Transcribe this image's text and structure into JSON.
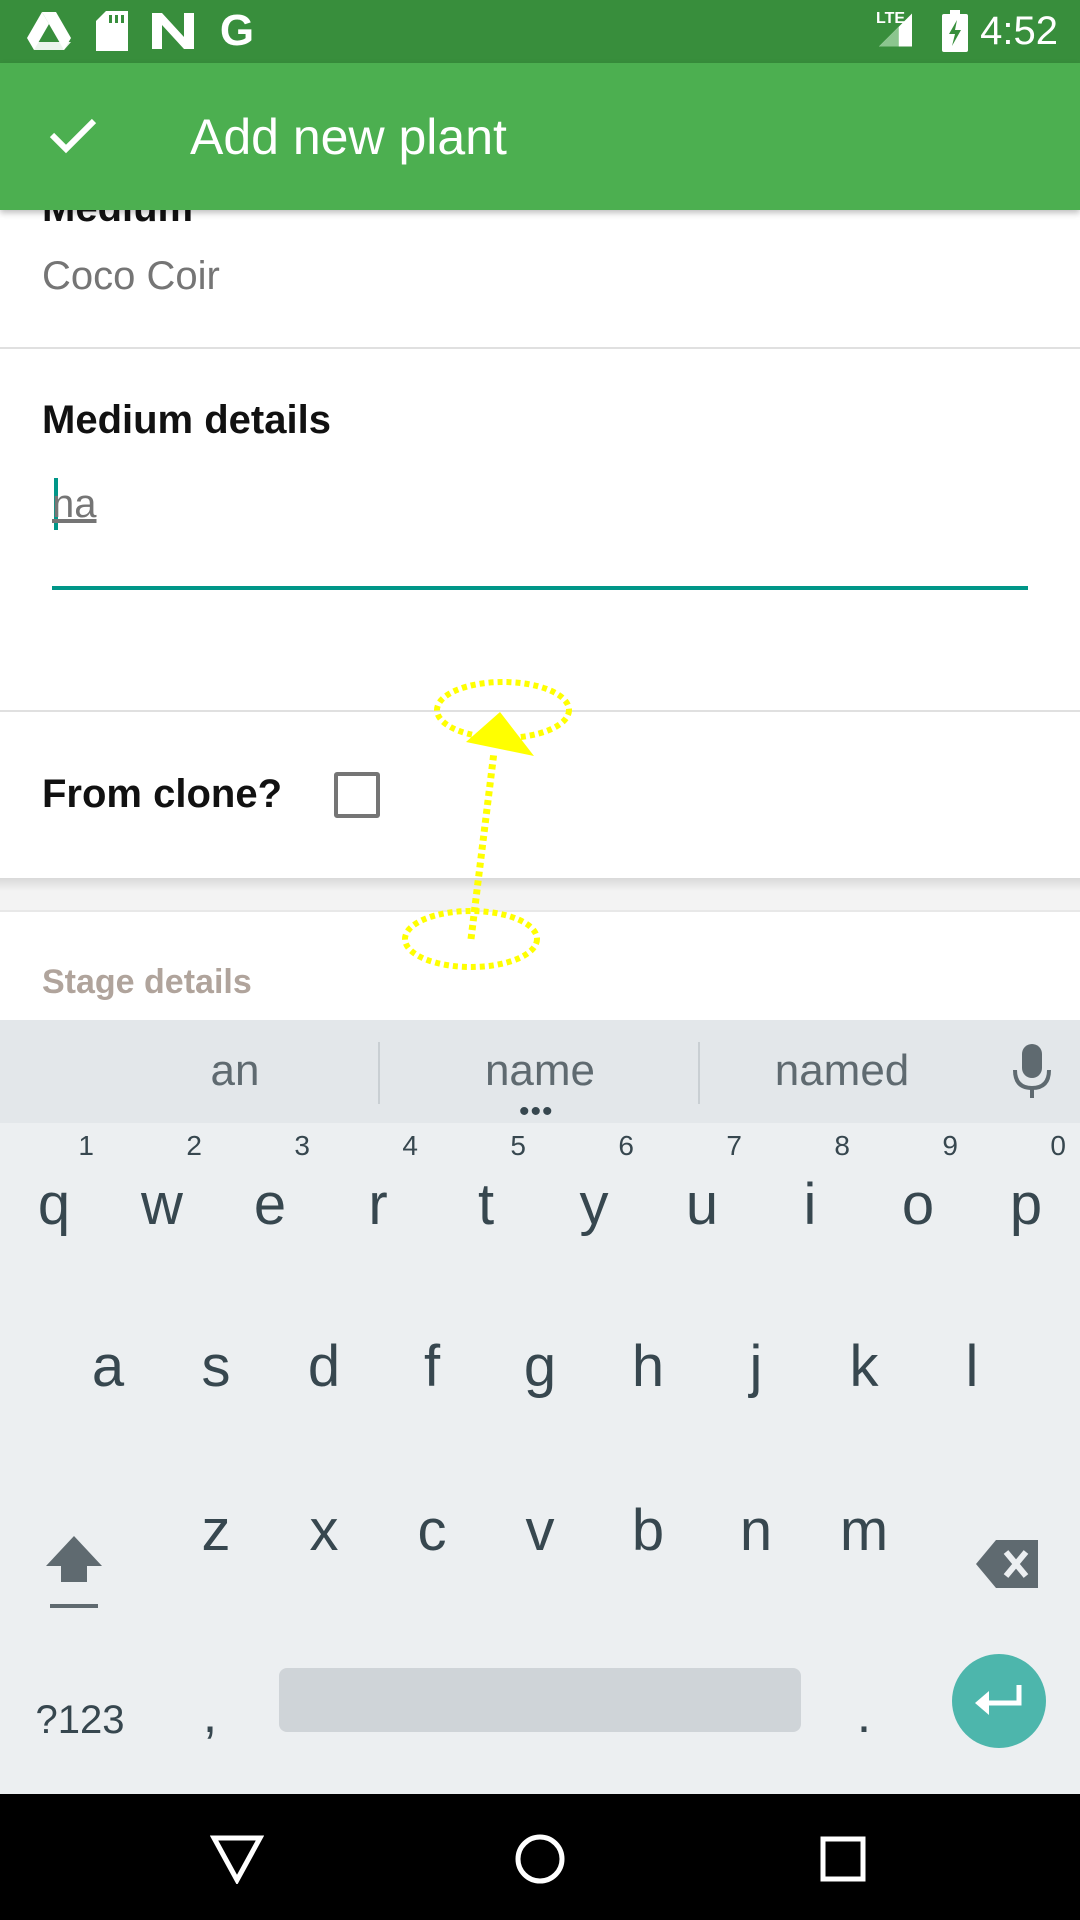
{
  "status_bar": {
    "time": "4:52",
    "network": "LTE",
    "left_icons": [
      "drive-icon",
      "sd-card-icon",
      "n-app-icon",
      "google-icon"
    ],
    "right_icons": [
      "lte-signal-icon",
      "battery-charging-icon"
    ],
    "google_glyph": "G"
  },
  "app_bar": {
    "title": "Add new plant",
    "action_icon": "checkmark-icon",
    "color": "#4caf50"
  },
  "form": {
    "medium_label": "Medium",
    "medium_value": "Coco Coir",
    "medium_details_label": "Medium details",
    "medium_details_value": "na",
    "from_clone_label": "From clone?",
    "from_clone_checked": false,
    "stage_details_label": "Stage details",
    "accent_color": "#009688"
  },
  "keyboard": {
    "suggestions": [
      "an",
      "name",
      "named"
    ],
    "rows": [
      [
        {
          "char": "q",
          "hint": "1"
        },
        {
          "char": "w",
          "hint": "2"
        },
        {
          "char": "e",
          "hint": "3"
        },
        {
          "char": "r",
          "hint": "4"
        },
        {
          "char": "t",
          "hint": "5"
        },
        {
          "char": "y",
          "hint": "6"
        },
        {
          "char": "u",
          "hint": "7"
        },
        {
          "char": "i",
          "hint": "8"
        },
        {
          "char": "o",
          "hint": "9"
        },
        {
          "char": "p",
          "hint": "0"
        }
      ],
      [
        {
          "char": "a"
        },
        {
          "char": "s"
        },
        {
          "char": "d"
        },
        {
          "char": "f"
        },
        {
          "char": "g"
        },
        {
          "char": "h"
        },
        {
          "char": "j"
        },
        {
          "char": "k"
        },
        {
          "char": "l"
        }
      ],
      [
        {
          "char": "z"
        },
        {
          "char": "x"
        },
        {
          "char": "c"
        },
        {
          "char": "v"
        },
        {
          "char": "b"
        },
        {
          "char": "n"
        },
        {
          "char": "m"
        }
      ]
    ],
    "symbols_label": "?123",
    "comma_label": ",",
    "period_label": ".",
    "more_dots": "•••",
    "enter_color": "#4db6ac"
  },
  "nav_bar": {
    "buttons": [
      "back-icon",
      "home-icon",
      "recents-icon"
    ]
  },
  "gesture": {
    "type": "swipe-up",
    "color": "#ffff00"
  }
}
